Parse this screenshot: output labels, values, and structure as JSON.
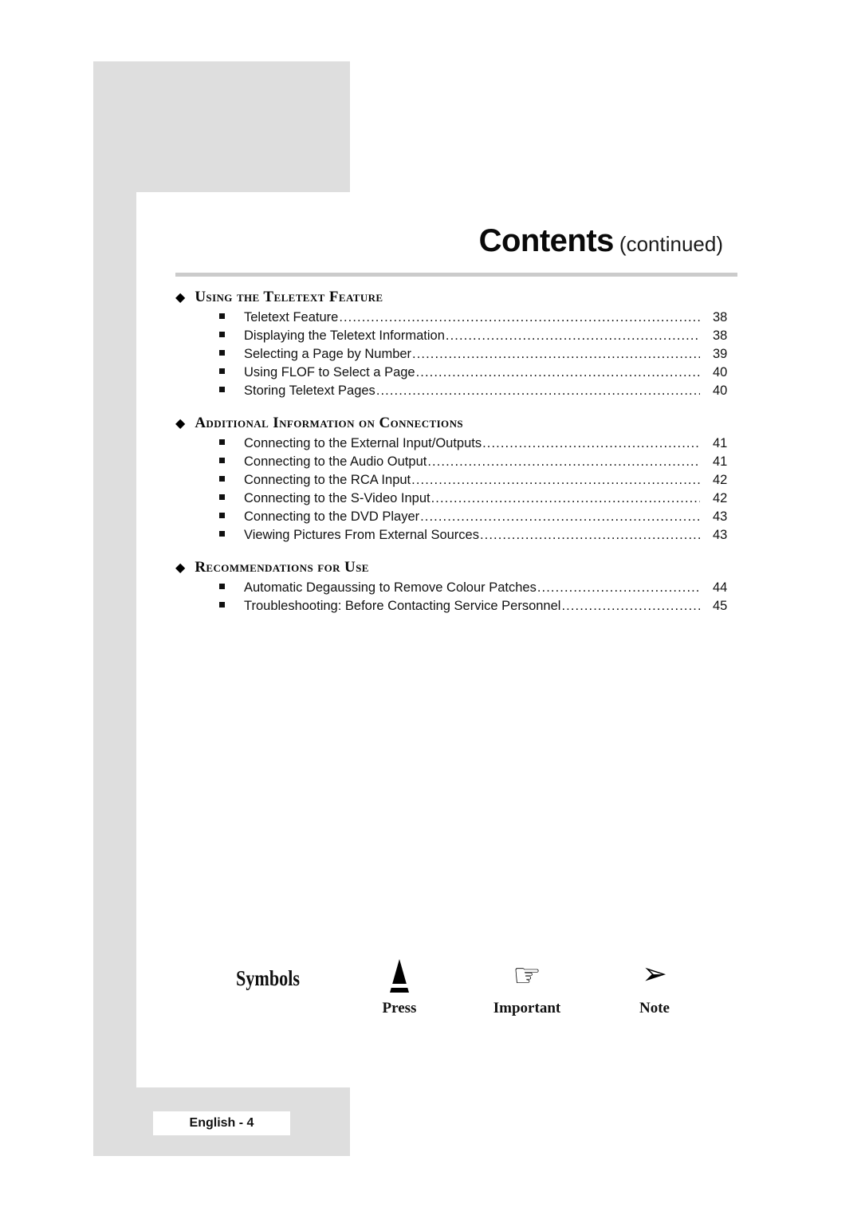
{
  "header": {
    "title": "Contents",
    "subtitle": "(continued)"
  },
  "contents": {
    "sections": [
      {
        "heading": "Using the Teletext Feature",
        "bullet_icon": "diamond-bullet",
        "entries": [
          {
            "label": "Teletext Feature",
            "page": "38"
          },
          {
            "label": "Displaying the Teletext Information",
            "page": "38"
          },
          {
            "label": "Selecting a Page by Number",
            "page": "39"
          },
          {
            "label": "Using FLOF to Select a Page",
            "page": "40"
          },
          {
            "label": "Storing Teletext Pages",
            "page": "40"
          }
        ]
      },
      {
        "heading": "Additional Information on Connections",
        "bullet_icon": "diamond-bullet",
        "entries": [
          {
            "label": "Connecting to the External Input/Outputs",
            "page": "41"
          },
          {
            "label": "Connecting to the Audio Output",
            "page": "41"
          },
          {
            "label": "Connecting to the RCA Input",
            "page": "42"
          },
          {
            "label": "Connecting to the S-Video Input",
            "page": "42"
          },
          {
            "label": "Connecting to the DVD Player",
            "page": "43"
          },
          {
            "label": "Viewing Pictures From External Sources",
            "page": "43"
          }
        ]
      },
      {
        "heading": "Recommendations for Use",
        "bullet_icon": "diamond-bullet",
        "entries": [
          {
            "label": "Automatic Degaussing to Remove Colour Patches",
            "page": "44"
          },
          {
            "label": "Troubleshooting: Before Contacting Service Personnel",
            "page": "45"
          }
        ]
      }
    ],
    "leader_char": "."
  },
  "symbols": {
    "label": "Symbols",
    "items": [
      {
        "name": "Press",
        "icon": "press-triangle-icon"
      },
      {
        "name": "Important",
        "icon": "pointing-hand-icon"
      },
      {
        "name": "Note",
        "icon": "note-arrow-icon"
      }
    ]
  },
  "footer": {
    "badge": "English - 4"
  },
  "colors": {
    "panel_grey": "#dedede",
    "rule_grey": "#cbcbcb",
    "text": "#111111"
  }
}
